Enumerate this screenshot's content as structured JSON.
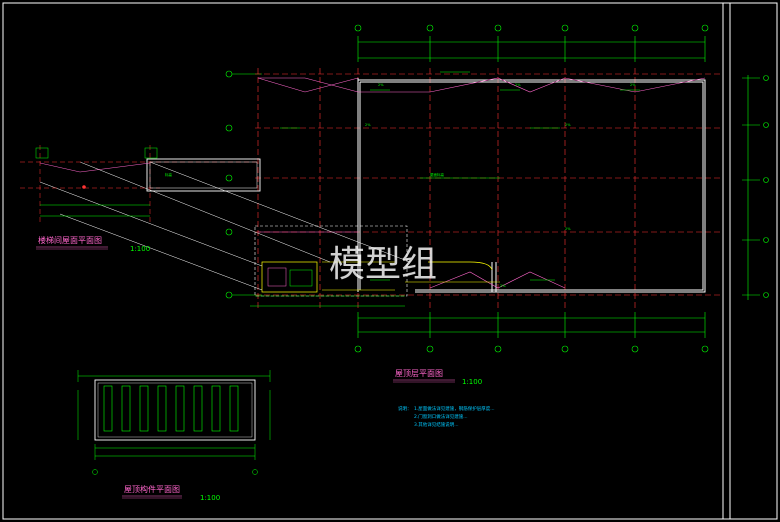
{
  "watermark": "模型组",
  "titles": {
    "stair_roof": {
      "name": "楼梯间屋面平面图",
      "scale": "1:100"
    },
    "roof_plan": {
      "name": "屋顶层平面图",
      "scale": "1:100"
    },
    "roof_component": {
      "name": "屋顶构件平面图",
      "scale": "1:100"
    }
  },
  "notes": {
    "heading": "说明：",
    "lines": [
      "1.屋面做法详见建施，钢筋保护层厚度...",
      "2.门窗洞口做法详见建施...",
      "3.其他详见结施说明..."
    ]
  },
  "plan_labels": {
    "slope_main": "2%",
    "center_mark": "屋面标高",
    "side_mark": "标高"
  },
  "grid_bubbles_top": [
    "①",
    "②",
    "③",
    "④",
    "⑤",
    "⑥"
  ],
  "grid_bubbles_left": [
    "Ⓐ",
    "Ⓑ",
    "Ⓒ",
    "Ⓓ",
    "Ⓔ"
  ],
  "colors": {
    "frame": "#ffffff",
    "axis": "#ff3333",
    "dim": "#00ff00",
    "slope": "#ff66cc",
    "wall": "#ffffff",
    "stair": "#ffff00",
    "bubble": "#00ff00"
  }
}
